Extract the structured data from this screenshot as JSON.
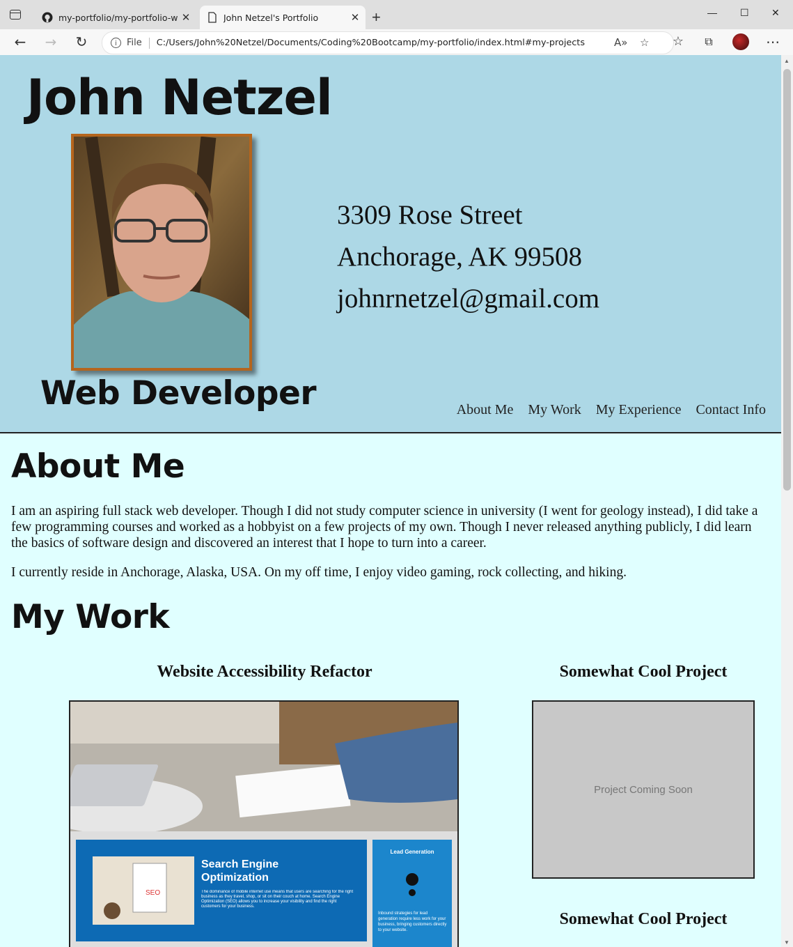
{
  "browser": {
    "tabs": [
      {
        "label": "my-portfolio/my-portfolio-wirefr",
        "icon": "github-icon",
        "active": false
      },
      {
        "label": "John Netzel's Portfolio",
        "icon": "page-icon",
        "active": true
      }
    ],
    "address": {
      "scheme_label": "File",
      "url": "C:/Users/John%20Netzel/Documents/Coding%20Bootcamp/my-portfolio/index.html#my-projects"
    }
  },
  "header": {
    "name": "John Netzel",
    "role": "Web Developer",
    "contact": {
      "street": "3309 Rose Street",
      "city": "Anchorage, AK 99508",
      "email": "johnrnetzel@gmail.com"
    },
    "nav": [
      "About Me",
      "My Work",
      "My Experience",
      "Contact Info"
    ]
  },
  "about": {
    "heading": "About Me",
    "paragraphs": [
      "I am an aspiring full stack web developer. Though I did not study computer science in university (I went for geology instead), I did take a few programming courses and worked as a hobbyist on a few projects of my own. Though I never released anything publicly, I did learn the basics of software design and discovered an interest that I hope to turn into a career.",
      "I currently reside in Anchorage, Alaska, USA. On my off time, I enjoy video gaming, rock collecting, and hiking."
    ]
  },
  "work": {
    "heading": "My Work",
    "projects": [
      {
        "title": "Website Accessibility Refactor"
      },
      {
        "title": "Somewhat Cool Project",
        "placeholder": "Project Coming Soon"
      },
      {
        "title": "Somewhat Cool Project"
      }
    ],
    "screenshot": {
      "hero_title_1": "Search Engine",
      "hero_title_2": "Optimization",
      "hero_text": "The dominance of mobile internet use means that users are searching for the right business as they travel, shop, or sit on their couch at home. Search Engine Optimization (SEO) allows you to increase your visibility and find the right customers for your business.",
      "side_title": "Lead Generation",
      "side_text": "Inbound strategies for lead generation require less work for your business, bringing customers directly to your website.",
      "seo_badge": "SEO"
    }
  },
  "colors": {
    "header_bg": "#add8e6",
    "page_bg": "#e0ffff",
    "frame": "#b5651d"
  }
}
